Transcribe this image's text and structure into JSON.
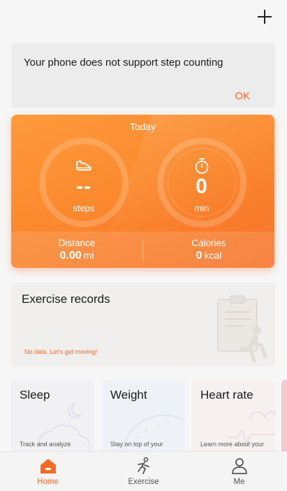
{
  "header": {
    "add_icon": "plus-icon"
  },
  "notice": {
    "message": "Your phone does not support step counting",
    "ok_label": "OK"
  },
  "today": {
    "title": "Today",
    "steps": {
      "icon": "shoe-icon",
      "value": "--",
      "unit": "steps"
    },
    "minutes": {
      "icon": "stopwatch-icon",
      "value": "0",
      "unit": "min"
    },
    "distance": {
      "label": "Distance",
      "value": "0.00",
      "unit": "mi"
    },
    "calories": {
      "label": "Calories",
      "value": "0",
      "unit": "kcal"
    },
    "colors": {
      "start": "#ff9a3c",
      "end": "#f7722a"
    }
  },
  "records": {
    "title": "Exercise records",
    "empty_text": "No data. Let's get moving!"
  },
  "tiles": [
    {
      "title": "Sleep",
      "desc": "Track and analyze"
    },
    {
      "title": "Weight",
      "desc": "Stay on top of your"
    },
    {
      "title": "Heart rate",
      "desc": "Learn more about your"
    }
  ],
  "nav": [
    {
      "label": "Home",
      "icon": "home-icon",
      "active": true
    },
    {
      "label": "Exercise",
      "icon": "runner-icon",
      "active": false
    },
    {
      "label": "Me",
      "icon": "person-icon",
      "active": false
    }
  ],
  "accent": "#f46a25"
}
